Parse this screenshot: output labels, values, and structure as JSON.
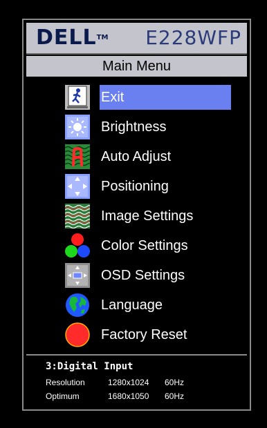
{
  "brand": {
    "logo_text": "DELL",
    "trademark": "TM",
    "model": "E228WFP"
  },
  "menu": {
    "title": "Main Menu",
    "selected": "Exit",
    "items": [
      {
        "label": "Exit",
        "icon": "exit-icon"
      },
      {
        "label": "Brightness",
        "icon": "brightness-icon"
      },
      {
        "label": "Auto Adjust",
        "icon": "auto-adjust-icon"
      },
      {
        "label": "Positioning",
        "icon": "positioning-icon"
      },
      {
        "label": "Image Settings",
        "icon": "image-settings-icon"
      },
      {
        "label": "Color Settings",
        "icon": "color-settings-icon"
      },
      {
        "label": "OSD Settings",
        "icon": "osd-settings-icon"
      },
      {
        "label": "Language",
        "icon": "language-icon"
      },
      {
        "label": "Factory Reset",
        "icon": "factory-reset-icon"
      }
    ]
  },
  "info": {
    "input": "3:Digital Input",
    "resolution_label": "Resolution",
    "resolution_value": "1280x1024",
    "resolution_hz": "60Hz",
    "optimum_label": "Optimum",
    "optimum_value": "1680x1050",
    "optimum_hz": "60Hz"
  },
  "colors": {
    "highlight": "#6a7ff0",
    "panel": "#c4c4cc",
    "background": "#000000",
    "factory_reset": "#ff2a2a"
  }
}
